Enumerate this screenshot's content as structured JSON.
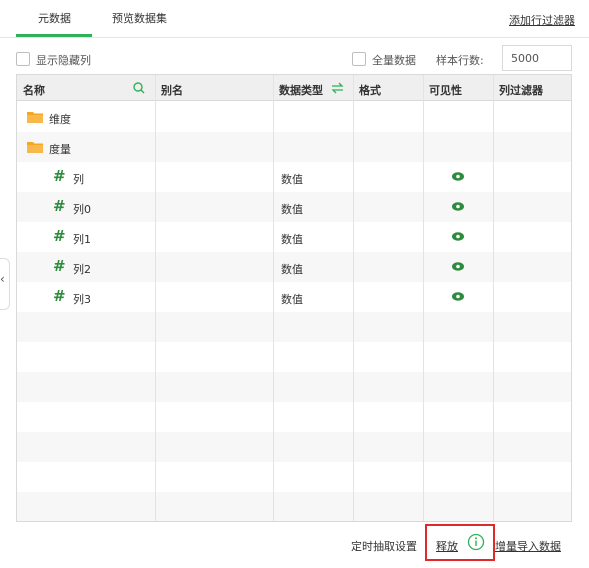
{
  "tabs": [
    {
      "label": "元数据",
      "active": true
    },
    {
      "label": "预览数据集",
      "active": false
    }
  ],
  "header": {
    "add_filter": "添加行过滤器"
  },
  "options": {
    "show_hidden_label": "显示隐藏列",
    "all_data_label": "全量数据",
    "sample_rows_label": "样本行数:",
    "sample_rows_value": "5000"
  },
  "grid": {
    "columns": [
      "名称",
      "别名",
      "数据类型",
      "格式",
      "可见性",
      "列过滤器"
    ],
    "rows": [
      {
        "icon": "folder-icon",
        "name": "维度",
        "type": "",
        "visible": false
      },
      {
        "icon": "folder-icon",
        "name": "度量",
        "type": "",
        "visible": false
      },
      {
        "icon": "hash-icon",
        "name": "列",
        "type": "数值",
        "visible": true
      },
      {
        "icon": "hash-icon",
        "name": "列0",
        "type": "数值",
        "visible": true
      },
      {
        "icon": "hash-icon",
        "name": "列1",
        "type": "数值",
        "visible": true
      },
      {
        "icon": "hash-icon",
        "name": "列2",
        "type": "数值",
        "visible": true
      },
      {
        "icon": "hash-icon",
        "name": "列3",
        "type": "数值",
        "visible": true
      }
    ],
    "hash_glyph": "#"
  },
  "footer": {
    "schedule_label": "定时抽取设置",
    "release_label": "释放",
    "import_label": "增量导入数据"
  },
  "handle": {
    "chevron": "‹"
  },
  "colors": {
    "accent": "#2eb158",
    "highlight": "#e02a2a",
    "folder": "#f5a623",
    "hash": "#2e8b3e"
  }
}
